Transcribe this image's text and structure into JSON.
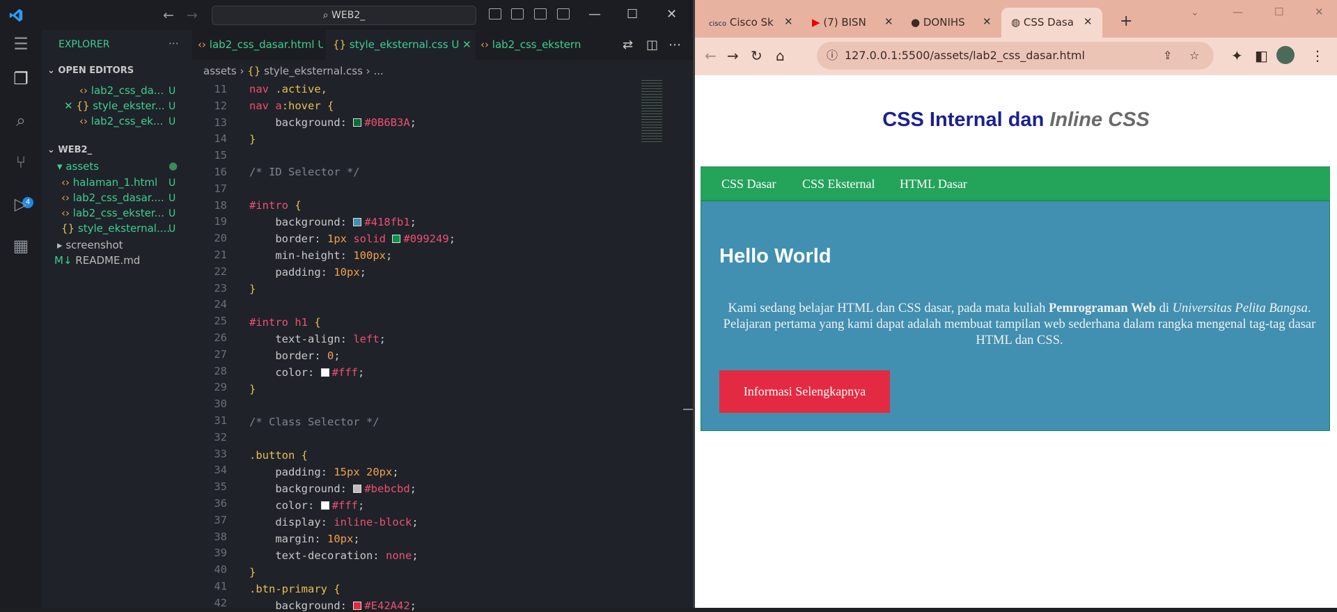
{
  "vscode": {
    "search": "WEB2_",
    "explorer_title": "EXPLORER",
    "open_editors": "OPEN EDITORS",
    "open_files": [
      {
        "name": "lab2_css_da...",
        "status": "U"
      },
      {
        "name": "style_ekster...",
        "status": "U"
      },
      {
        "name": "lab2_css_ek...",
        "status": "U"
      }
    ],
    "workspace": "WEB2_",
    "folder": "assets",
    "files": [
      {
        "name": "halaman_1.html",
        "status": "U"
      },
      {
        "name": "lab2_css_dasar....",
        "status": "U"
      },
      {
        "name": "lab2_css_ekster...",
        "status": "U"
      },
      {
        "name": "style_eksternal....",
        "status": "U"
      }
    ],
    "screenshot": "screenshot",
    "readme": "README.md",
    "scm_badge": "4",
    "tabs": [
      {
        "label": "lab2_css_dasar.html",
        "status": "U"
      },
      {
        "label": "style_eksternal.css",
        "status": "U"
      },
      {
        "label": "lab2_css_ekstern"
      }
    ],
    "breadcrumb": {
      "folder": "assets",
      "file": "style_eksternal.css",
      "more": "..."
    },
    "lines": [
      "11",
      "12",
      "13",
      "14",
      "15",
      "16",
      "17",
      "18",
      "19",
      "20",
      "21",
      "22",
      "23",
      "24",
      "25",
      "26",
      "27",
      "28",
      "29",
      "30",
      "31",
      "32",
      "33",
      "34",
      "35",
      "36",
      "37",
      "38",
      "39",
      "40",
      "41",
      "42"
    ],
    "code": {
      "l11a": "nav",
      ".l11b": "",
      "l11": ".active,",
      "l12a": "nav",
      "l12b": "a",
      ":hover": ":hover {",
      "l13p": "background:",
      "l13v": "#0B6B3A",
      "l16": "/* ID Selector */",
      "l18a": "#intro",
      "l19p": "background:",
      "l19v": "#418fb1",
      "l20p": "border:",
      "l20a": "1px",
      "l20b": "solid",
      "l20v": "#099249",
      "l21p": "min-height:",
      "l21v": "100px",
      "l22p": "padding:",
      "l22v": "10px",
      "l25a": "#intro",
      "l25b": "h1",
      "l26p": "text-align:",
      "l26v": "left",
      "l27p": "border:",
      "l27v": "0",
      "l28p": "color:",
      "l28v": "#fff",
      "l31": "/* Class Selector */",
      "l33a": ".button",
      "l34p": "padding:",
      "l34v": "15px 20px",
      "l35p": "background:",
      "l35v": "#bebcbd",
      "l36p": "color:",
      "l36v": "#fff",
      "l37p": "display:",
      "l37v": "inline-block",
      "l38p": "margin:",
      "l38v": "10px",
      "l39p": "text-decoration:",
      "l39v": "none",
      "l41a": ".btn-primary",
      "l42p": "background:",
      "l42v": "#E42A42"
    }
  },
  "browser": {
    "tabs": [
      "Cisco Sk",
      "(7) BISN",
      "DONIHS",
      "CSS Dasa"
    ],
    "url": "127.0.0.1:5500/assets/lab2_css_dasar.html",
    "page": {
      "title_a": "CSS Internal dan ",
      "title_b": "Inline CSS",
      "nav": [
        "CSS Dasar",
        "CSS Eksternal",
        "HTML Dasar"
      ],
      "heading": "Hello World",
      "para_1": "Kami sedang belajar HTML dan CSS dasar, pada mata kuliah ",
      "para_bold": "Pemrograman Web",
      "para_2": " di ",
      "para_italic": "Universitas Pelita Bangsa",
      "para_3": ". Pelajaran pertama yang kami dapat adalah membuat tampilan web sederhana dalam rangka mengenal tag-tag dasar HTML dan CSS.",
      "button": "Informasi Selengkapnya"
    }
  }
}
